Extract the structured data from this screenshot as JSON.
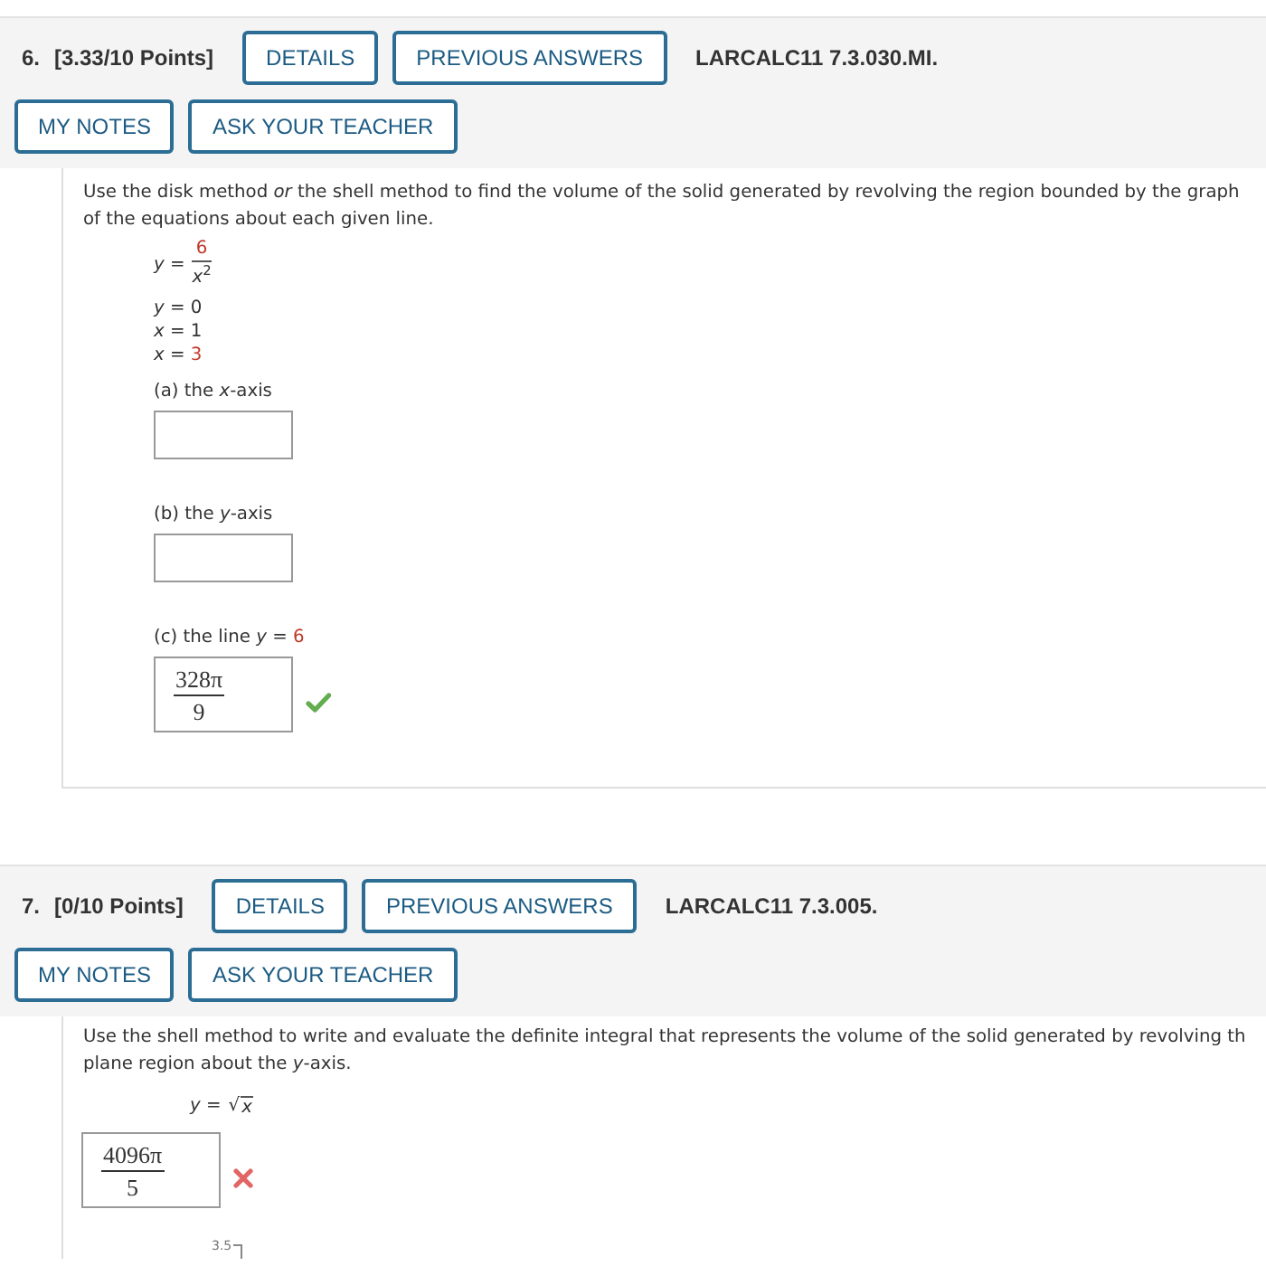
{
  "questions": [
    {
      "number": "6.",
      "points": "[3.33/10 Points]",
      "buttons": [
        "DETAILS",
        "PREVIOUS ANSWERS"
      ],
      "reference": "LARCALC11 7.3.030.MI.",
      "actions": [
        "MY NOTES",
        "ASK YOUR TEACHER"
      ],
      "prompt": "Use the disk method *or* the shell method to find the volume of the solid generated by revolving the region bounded by the graph\nof the equations about each given line.",
      "equations": [
        {
          "kind": "fraction",
          "lhs": "*y* =",
          "numerator": "6",
          "denominator": "*x*$^{2}$",
          "highlighted": true
        },
        {
          "kind": "plain",
          "lhs": "*y* =",
          "value": "0",
          "highlighted": false
        },
        {
          "kind": "plain",
          "lhs": "*x* =",
          "value": "1",
          "highlighted": false
        },
        {
          "kind": "plain",
          "lhs": "*x* =",
          "value": "3",
          "highlighted": true
        }
      ],
      "parts": [
        {
          "label": "(a) the *x*-axis"
        },
        {
          "label": "(b) the *y*-axis"
        },
        {
          "label": "(c) the line *y* =",
          "value": "6",
          "highlighted": true,
          "answer": {
            "numerator": "328π",
            "denominator": "9"
          },
          "correct": true
        }
      ]
    },
    {
      "number": "7.",
      "points": "[0/10 Points]",
      "buttons": [
        "DETAILS",
        "PREVIOUS ANSWERS"
      ],
      "reference": "LARCALC11 7.3.005.",
      "actions": [
        "MY NOTES",
        "ASK YOUR TEACHER"
      ],
      "prompt": "Use the shell method to write and evaluate the definite integral that represents the volume of the solid generated by revolving th\nplane region about the *y*-axis.",
      "equations": [
        {
          "kind": "sqrt",
          "lhs": "*y* =",
          "radical": "√",
          "radicand": "*x*"
        }
      ],
      "parts": [
        {
          "answer": {
            "numerator": "4096π",
            "denominator": "5"
          },
          "correct": false
        }
      ],
      "graph": {
        "tick_label": "3.5"
      }
    }
  ]
}
